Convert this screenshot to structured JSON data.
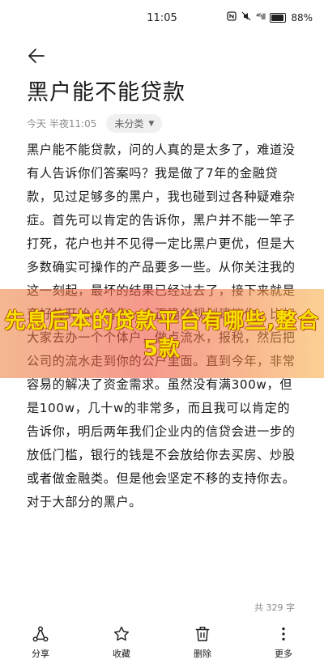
{
  "status_bar": {
    "time": "11:05",
    "signal": "⁴⁶ıll",
    "battery": "88%"
  },
  "note": {
    "title": "黑户能不能贷款",
    "date": "今天 半夜11:05",
    "category": "未分类",
    "body": "黑户能不能贷款，问的人真的是太多了，难道没有人告诉你们答案吗？我是做了7年的金融贷款，见过足够多的黑户，我也碰到过各种疑难杂症。首先可以肯定的告诉你，黑户并不能一竿子打死，花户也并不见得一定比黑户更优，但是大多数确实可操作的产品要多一些。从你关注我的这一刻起，最坏的结果已经过去了，接下来就是变好的开始。给你一个正确的规划建议你，比如大家去办一个个体户，做点流水，报税，然后把公司的流水走到你的公户里面。直到今年，非常容易的解决了资金需求。虽然没有满300w，但是100w，几十w的非常多，而且我可以肯定的告诉你，明后两年我们企业内的信贷会进一步的放低门槛，银行的钱是不会放给你去买房、炒股或者做金融类。但是他会坚定不移的支持你去。对于大部分的黑户。",
    "word_count": "共 329 字"
  },
  "overlay": {
    "headline": "先息后本的贷款平台有哪些,整合5款"
  },
  "toolbar": {
    "share": "分享",
    "favorite": "收藏",
    "delete": "删除",
    "more": "更多"
  }
}
